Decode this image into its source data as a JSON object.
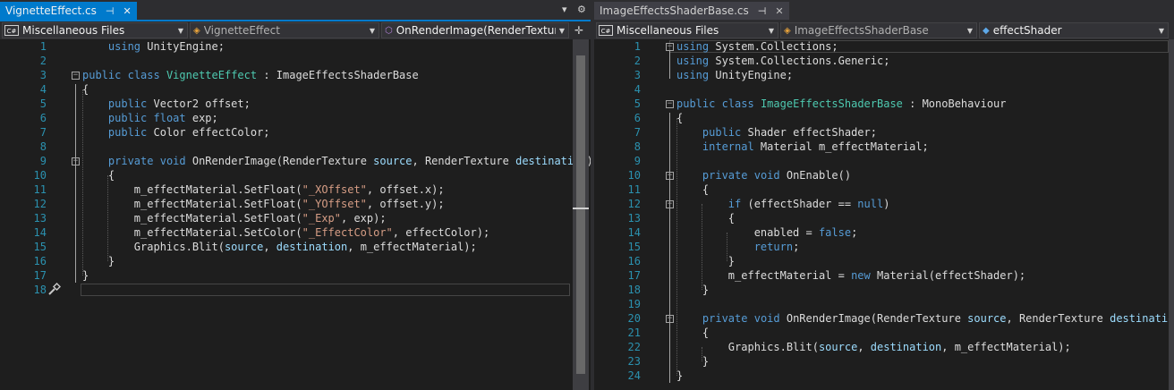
{
  "left": {
    "tab": {
      "name": "VignetteEffect.cs",
      "pin": "⊣",
      "close": "✕"
    },
    "tab_dropdown": "▾",
    "tab_settings": "⚙",
    "project_combo": "Miscellaneous Files",
    "class_combo": "VignetteEffect",
    "member_combo": "OnRenderImage(RenderTexture s",
    "split_symbol": "✛",
    "lines": [
      [
        [
          "pl",
          "    "
        ],
        [
          "kw",
          "using"
        ],
        [
          "pl",
          " UnityEngine;"
        ]
      ],
      [],
      [
        [
          "kw",
          "public"
        ],
        [
          "pl",
          " "
        ],
        [
          "kw",
          "class"
        ],
        [
          "pl",
          " "
        ],
        [
          "ty",
          "VignetteEffect"
        ],
        [
          "pl",
          " : ImageEffectsShaderBase"
        ]
      ],
      [
        [
          "pl",
          "{"
        ]
      ],
      [
        [
          "pl",
          "    "
        ],
        [
          "kw",
          "public"
        ],
        [
          "pl",
          " Vector2 offset;"
        ]
      ],
      [
        [
          "pl",
          "    "
        ],
        [
          "kw",
          "public"
        ],
        [
          "pl",
          " "
        ],
        [
          "kw",
          "float"
        ],
        [
          "pl",
          " exp;"
        ]
      ],
      [
        [
          "pl",
          "    "
        ],
        [
          "kw",
          "public"
        ],
        [
          "pl",
          " Color effectColor;"
        ]
      ],
      [],
      [
        [
          "pl",
          "    "
        ],
        [
          "kw",
          "private"
        ],
        [
          "pl",
          " "
        ],
        [
          "kw",
          "void"
        ],
        [
          "pl",
          " OnRenderImage(RenderTexture "
        ],
        [
          "prm",
          "source"
        ],
        [
          "pl",
          ", RenderTexture "
        ],
        [
          "prm",
          "destination"
        ],
        [
          "pl",
          ")"
        ]
      ],
      [
        [
          "pl",
          "    {"
        ]
      ],
      [
        [
          "pl",
          "        m_effectMaterial.SetFloat("
        ],
        [
          "str",
          "\"_XOffset\""
        ],
        [
          "pl",
          ", offset.x);"
        ]
      ],
      [
        [
          "pl",
          "        m_effectMaterial.SetFloat("
        ],
        [
          "str",
          "\"_YOffset\""
        ],
        [
          "pl",
          ", offset.y);"
        ]
      ],
      [
        [
          "pl",
          "        m_effectMaterial.SetFloat("
        ],
        [
          "str",
          "\"_Exp\""
        ],
        [
          "pl",
          ", exp);"
        ]
      ],
      [
        [
          "pl",
          "        m_effectMaterial.SetColor("
        ],
        [
          "str",
          "\"_EffectColor\""
        ],
        [
          "pl",
          ", effectColor);"
        ]
      ],
      [
        [
          "pl",
          "        Graphics.Blit("
        ],
        [
          "prm",
          "source"
        ],
        [
          "pl",
          ", "
        ],
        [
          "prm",
          "destination"
        ],
        [
          "pl",
          ", m_effectMaterial);"
        ]
      ],
      [
        [
          "pl",
          "    }"
        ]
      ],
      [
        [
          "pl",
          "}"
        ]
      ],
      []
    ]
  },
  "right": {
    "tab": {
      "name": "ImageEffectsShaderBase.cs",
      "pin": "⊣",
      "close": "✕"
    },
    "project_combo": "Miscellaneous Files",
    "class_combo": "ImageEffectsShaderBase",
    "member_combo": "effectShader",
    "lines": [
      [
        [
          "kw",
          "using"
        ],
        [
          "pl",
          " System.Collections;"
        ]
      ],
      [
        [
          "kw",
          "using"
        ],
        [
          "pl",
          " System.Collections.Generic;"
        ]
      ],
      [
        [
          "kw",
          "using"
        ],
        [
          "pl",
          " UnityEngine;"
        ]
      ],
      [],
      [
        [
          "kw",
          "public"
        ],
        [
          "pl",
          " "
        ],
        [
          "kw",
          "class"
        ],
        [
          "pl",
          " "
        ],
        [
          "ty",
          "ImageEffectsShaderBase"
        ],
        [
          "pl",
          " : MonoBehaviour"
        ]
      ],
      [
        [
          "pl",
          "{"
        ]
      ],
      [
        [
          "pl",
          "    "
        ],
        [
          "kw",
          "public"
        ],
        [
          "pl",
          " Shader effectShader;"
        ]
      ],
      [
        [
          "pl",
          "    "
        ],
        [
          "kw",
          "internal"
        ],
        [
          "pl",
          " Material m_effectMaterial;"
        ]
      ],
      [],
      [
        [
          "pl",
          "    "
        ],
        [
          "kw",
          "private"
        ],
        [
          "pl",
          " "
        ],
        [
          "kw",
          "void"
        ],
        [
          "pl",
          " OnEnable()"
        ]
      ],
      [
        [
          "pl",
          "    {"
        ]
      ],
      [
        [
          "pl",
          "        "
        ],
        [
          "kw",
          "if"
        ],
        [
          "pl",
          " (effectShader == "
        ],
        [
          "kw",
          "null"
        ],
        [
          "pl",
          ")"
        ]
      ],
      [
        [
          "pl",
          "        {"
        ]
      ],
      [
        [
          "pl",
          "            enabled = "
        ],
        [
          "kw",
          "false"
        ],
        [
          "pl",
          ";"
        ]
      ],
      [
        [
          "pl",
          "            "
        ],
        [
          "kw",
          "return"
        ],
        [
          "pl",
          ";"
        ]
      ],
      [
        [
          "pl",
          "        }"
        ]
      ],
      [
        [
          "pl",
          "        m_effectMaterial = "
        ],
        [
          "kw",
          "new"
        ],
        [
          "pl",
          " Material(effectShader);"
        ]
      ],
      [
        [
          "pl",
          "    }"
        ]
      ],
      [],
      [
        [
          "pl",
          "    "
        ],
        [
          "kw",
          "private"
        ],
        [
          "pl",
          " "
        ],
        [
          "kw",
          "void"
        ],
        [
          "pl",
          " OnRenderImage(RenderTexture "
        ],
        [
          "prm",
          "source"
        ],
        [
          "pl",
          ", RenderTexture "
        ],
        [
          "prm",
          "destination"
        ],
        [
          "pl",
          ")"
        ]
      ],
      [
        [
          "pl",
          "    {"
        ]
      ],
      [
        [
          "pl",
          "        Graphics.Blit("
        ],
        [
          "prm",
          "source"
        ],
        [
          "pl",
          ", "
        ],
        [
          "prm",
          "destination"
        ],
        [
          "pl",
          ", m_effectMaterial);"
        ]
      ],
      [
        [
          "pl",
          "    }"
        ]
      ],
      [
        [
          "pl",
          "}"
        ]
      ]
    ]
  },
  "icons": {
    "cs_badge": "C#",
    "class_icon": "class-icon",
    "method_icon": "method-icon",
    "field_icon": "field-icon",
    "quick_action_icon": "screwdriver-icon"
  },
  "colors": {
    "keyword": "#569cd6",
    "type": "#4ec9b0",
    "string": "#d69d85",
    "line_number": "#2b91af",
    "active_tab": "#007acc",
    "background": "#1e1e1e"
  }
}
